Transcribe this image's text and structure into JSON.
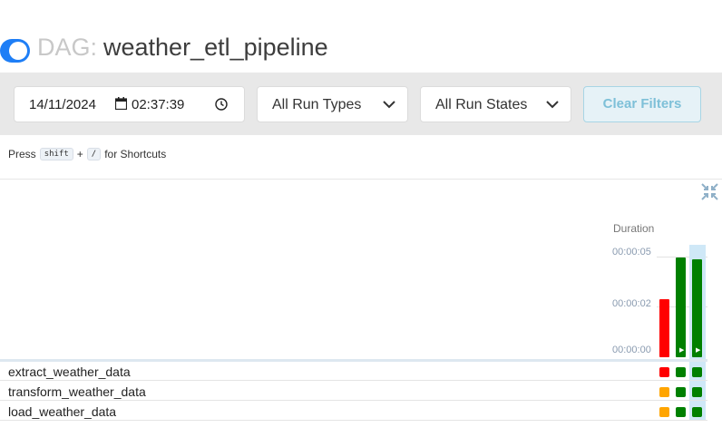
{
  "header": {
    "dag_prefix": "DAG:",
    "dag_id": "weather_etl_pipeline",
    "toggle_color": "#1e7ef6"
  },
  "filters": {
    "date": "14/11/2024",
    "time": "02:37:39",
    "run_types": "All Run Types",
    "run_states": "All Run States",
    "clear_label": "Clear Filters"
  },
  "shortcut": {
    "prefix": "Press",
    "key1": "shift",
    "plus": "+",
    "key2": "/",
    "suffix": "for Shortcuts"
  },
  "grid": {
    "duration_label": "Duration",
    "ticks": [
      "00:00:05",
      "00:00:02",
      "00:00:00"
    ],
    "runs": [
      {
        "duration_seconds": 2.6,
        "state_color": "#ff0000",
        "has_play": false
      },
      {
        "duration_seconds": 4.5,
        "state_color": "#008000",
        "has_play": true
      },
      {
        "duration_seconds": 4.4,
        "state_color": "#008000",
        "has_play": true
      }
    ],
    "tasks": [
      {
        "name": "extract_weather_data",
        "states": [
          "#ff0000",
          "#008000",
          "#008000"
        ]
      },
      {
        "name": "transform_weather_data",
        "states": [
          "#ffa500",
          "#008000",
          "#008000"
        ]
      },
      {
        "name": "load_weather_data",
        "states": [
          "#ffa500",
          "#008000",
          "#008000"
        ]
      }
    ]
  }
}
